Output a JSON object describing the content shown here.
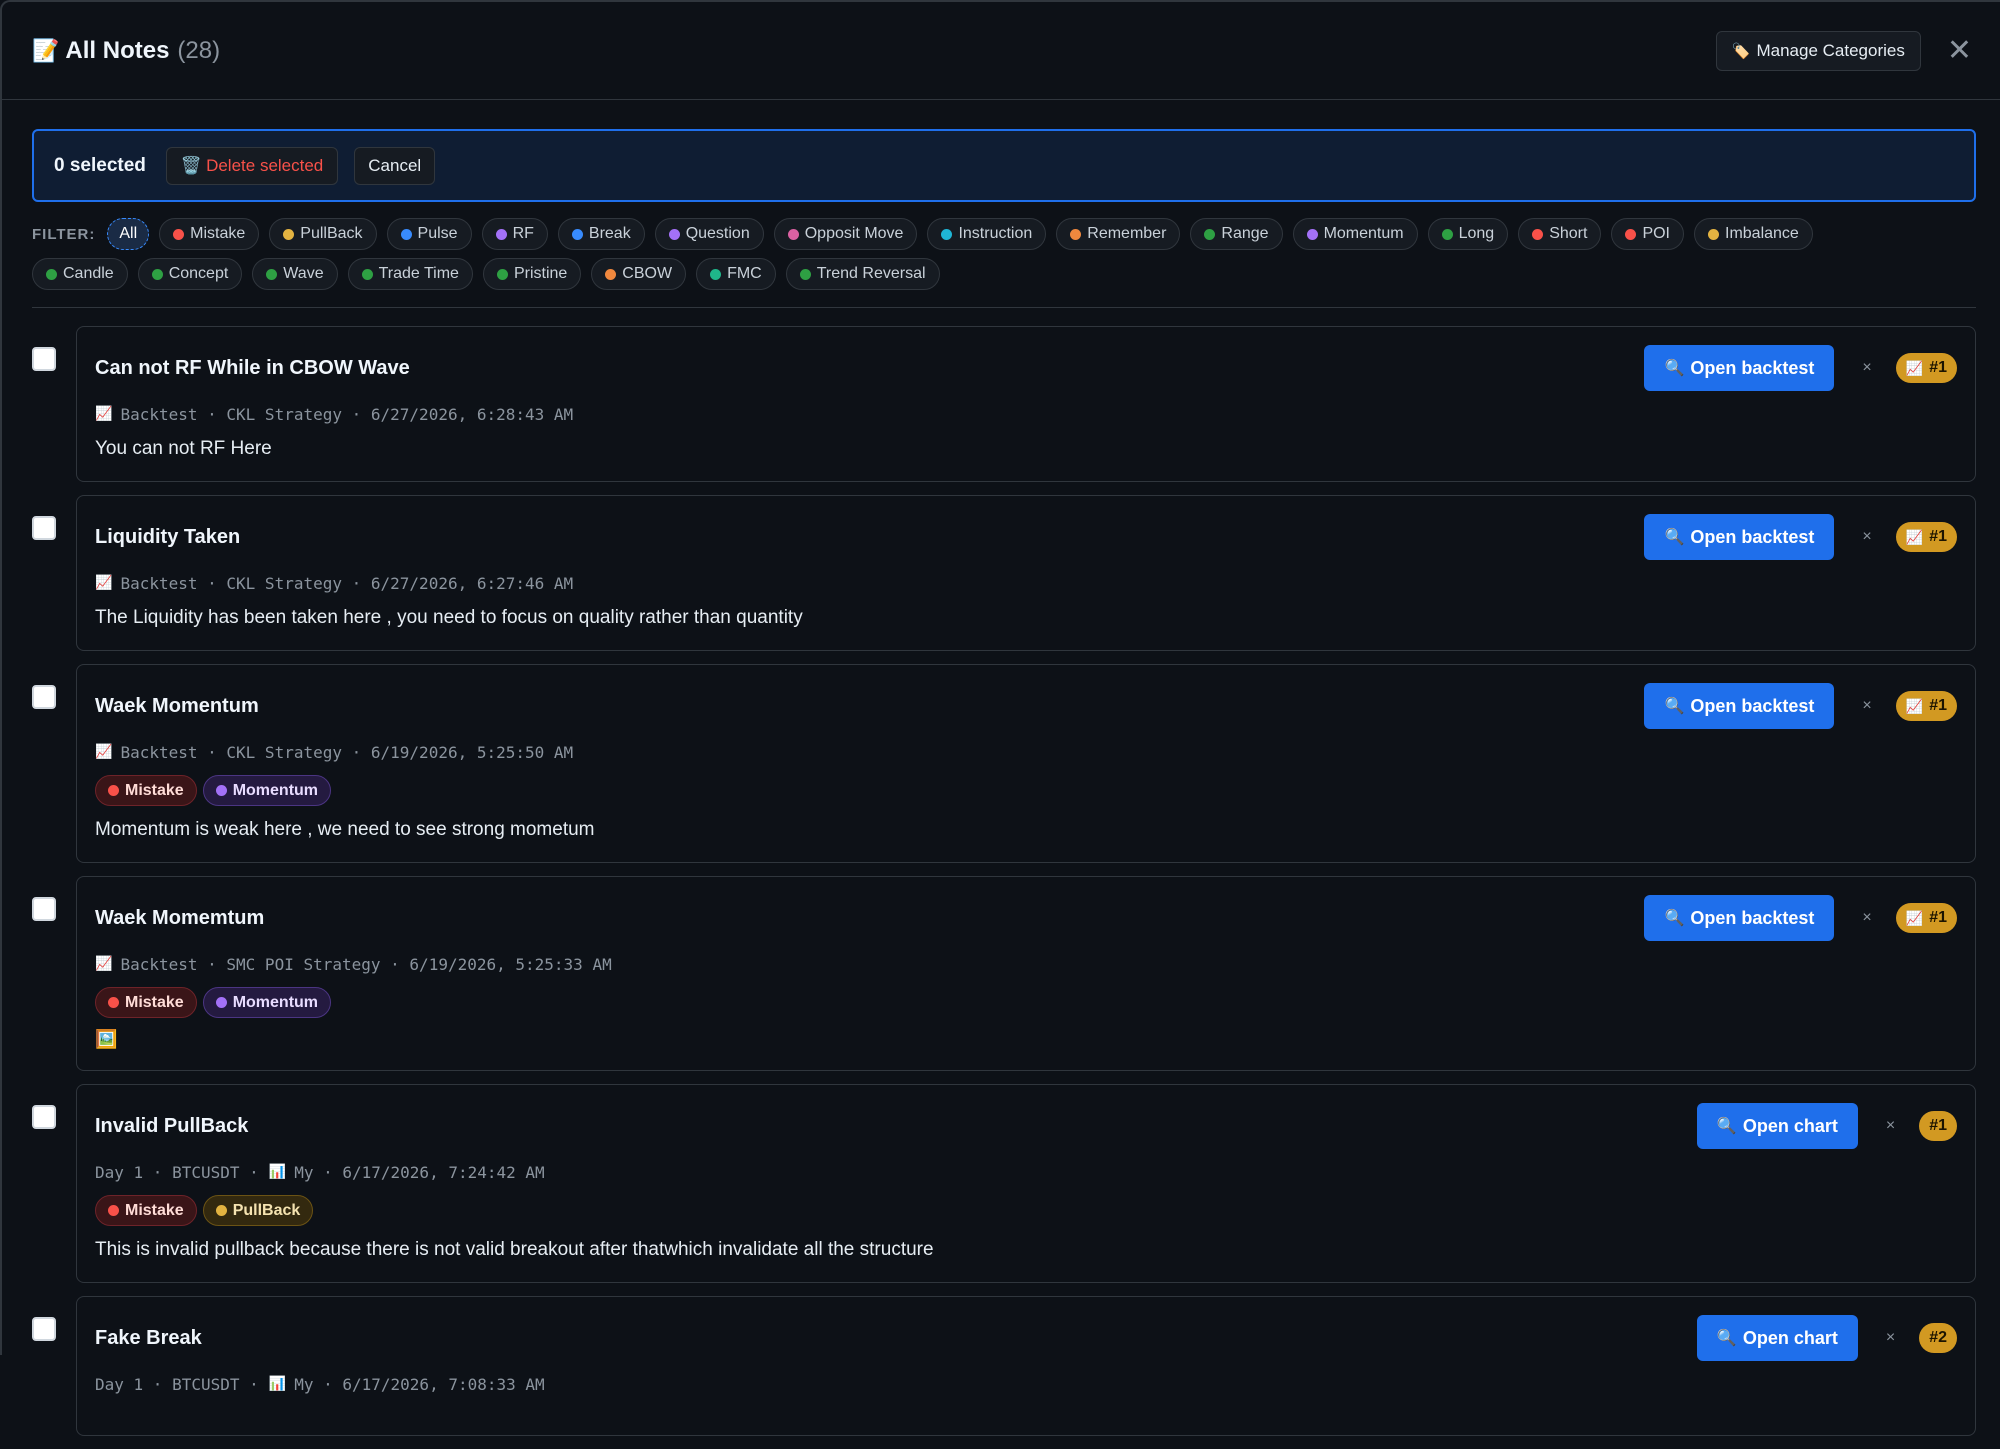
{
  "header": {
    "title_icon": "memo-icon",
    "title": "All Notes",
    "count": "(28)",
    "manage_label": "Manage Categories",
    "close_label": "✕"
  },
  "selection": {
    "count_label": "0 selected",
    "delete_label": "Delete selected",
    "cancel_label": "Cancel"
  },
  "filter": {
    "label": "FILTER:",
    "row1": [
      {
        "label": "All",
        "color": "",
        "active": true
      },
      {
        "label": "Mistake",
        "color": "#f85149"
      },
      {
        "label": "PullBack",
        "color": "#e3b341"
      },
      {
        "label": "Pulse",
        "color": "#388bfd"
      },
      {
        "label": "RF",
        "color": "#a371f7"
      },
      {
        "label": "Break",
        "color": "#388bfd"
      },
      {
        "label": "Question",
        "color": "#a371f7"
      },
      {
        "label": "Opposit Move",
        "color": "#db61a2"
      },
      {
        "label": "Instruction",
        "color": "#1fb6d6"
      },
      {
        "label": "Remember",
        "color": "#f0883e"
      },
      {
        "label": "Range",
        "color": "#2ea043"
      },
      {
        "label": "Momentum",
        "color": "#a371f7"
      },
      {
        "label": "Long",
        "color": "#2ea043"
      },
      {
        "label": "Short",
        "color": "#f85149"
      },
      {
        "label": "POI",
        "color": "#f85149"
      },
      {
        "label": "Imbalance",
        "color": "#e3b341"
      }
    ],
    "row2": [
      {
        "label": "Candle",
        "color": "#2ea043"
      },
      {
        "label": "Concept",
        "color": "#2ea043"
      },
      {
        "label": "Wave",
        "color": "#2ea043"
      },
      {
        "label": "Trade Time",
        "color": "#2ea043"
      },
      {
        "label": "Pristine",
        "color": "#2ea043"
      },
      {
        "label": "CBOW",
        "color": "#f0883e"
      },
      {
        "label": "FMC",
        "color": "#1fb68a"
      },
      {
        "label": "Trend Reversal",
        "color": "#2ea043"
      }
    ]
  },
  "notes": [
    {
      "title": "Can not RF While in CBOW Wave",
      "meta_icon": "chart-increasing-icon",
      "meta": "Backtest · CKL Strategy · 6/27/2026, 6:28:43 AM",
      "tags": [],
      "body": "You can not RF Here",
      "action": "Open backtest",
      "badge": "#1",
      "badge_icon": true
    },
    {
      "title": "Liquidity Taken",
      "meta_icon": "chart-increasing-icon",
      "meta": "Backtest · CKL Strategy · 6/27/2026, 6:27:46 AM",
      "tags": [],
      "body": "The Liquidity has been taken here , you need to focus on quality rather than quantity",
      "action": "Open backtest",
      "badge": "#1",
      "badge_icon": true
    },
    {
      "title": "Waek Momentum",
      "meta_icon": "chart-increasing-icon",
      "meta": "Backtest · CKL Strategy · 6/19/2026, 5:25:50 AM",
      "tags": [
        {
          "label": "Mistake",
          "color": "#f85149",
          "kind": "mistake"
        },
        {
          "label": "Momentum",
          "color": "#a371f7",
          "kind": "momentum"
        }
      ],
      "body": "Momentum is weak here , we need to see strong mometum",
      "action": "Open backtest",
      "badge": "#1",
      "badge_icon": true
    },
    {
      "title": "Waek Momemtum",
      "meta_icon": "chart-increasing-icon",
      "meta": "Backtest · SMC POI Strategy · 6/19/2026, 5:25:33 AM",
      "tags": [
        {
          "label": "Mistake",
          "color": "#f85149",
          "kind": "mistake"
        },
        {
          "label": "Momentum",
          "color": "#a371f7",
          "kind": "momentum"
        }
      ],
      "body": "",
      "image": true,
      "action": "Open backtest",
      "badge": "#1",
      "badge_icon": true
    },
    {
      "title": "Invalid PullBack",
      "meta_prefix": "Day 1 · BTCUSDT ·",
      "meta_icon": "bar-chart-icon",
      "meta": "My · 6/17/2026, 7:24:42 AM",
      "tags": [
        {
          "label": "Mistake",
          "color": "#f85149",
          "kind": "mistake"
        },
        {
          "label": "PullBack",
          "color": "#e3b341",
          "kind": "pullback"
        }
      ],
      "body": "This is invalid pullback because there is not valid breakout after thatwhich invalidate all the structure",
      "action": "Open chart",
      "badge": "#1",
      "badge_icon": false
    },
    {
      "title": "Fake Break",
      "meta_prefix": "Day 1 · BTCUSDT ·",
      "meta_icon": "bar-chart-icon",
      "meta": "My · 6/17/2026, 7:08:33 AM",
      "tags": [],
      "body": "",
      "action": "Open chart",
      "badge": "#2",
      "badge_icon": false
    }
  ]
}
